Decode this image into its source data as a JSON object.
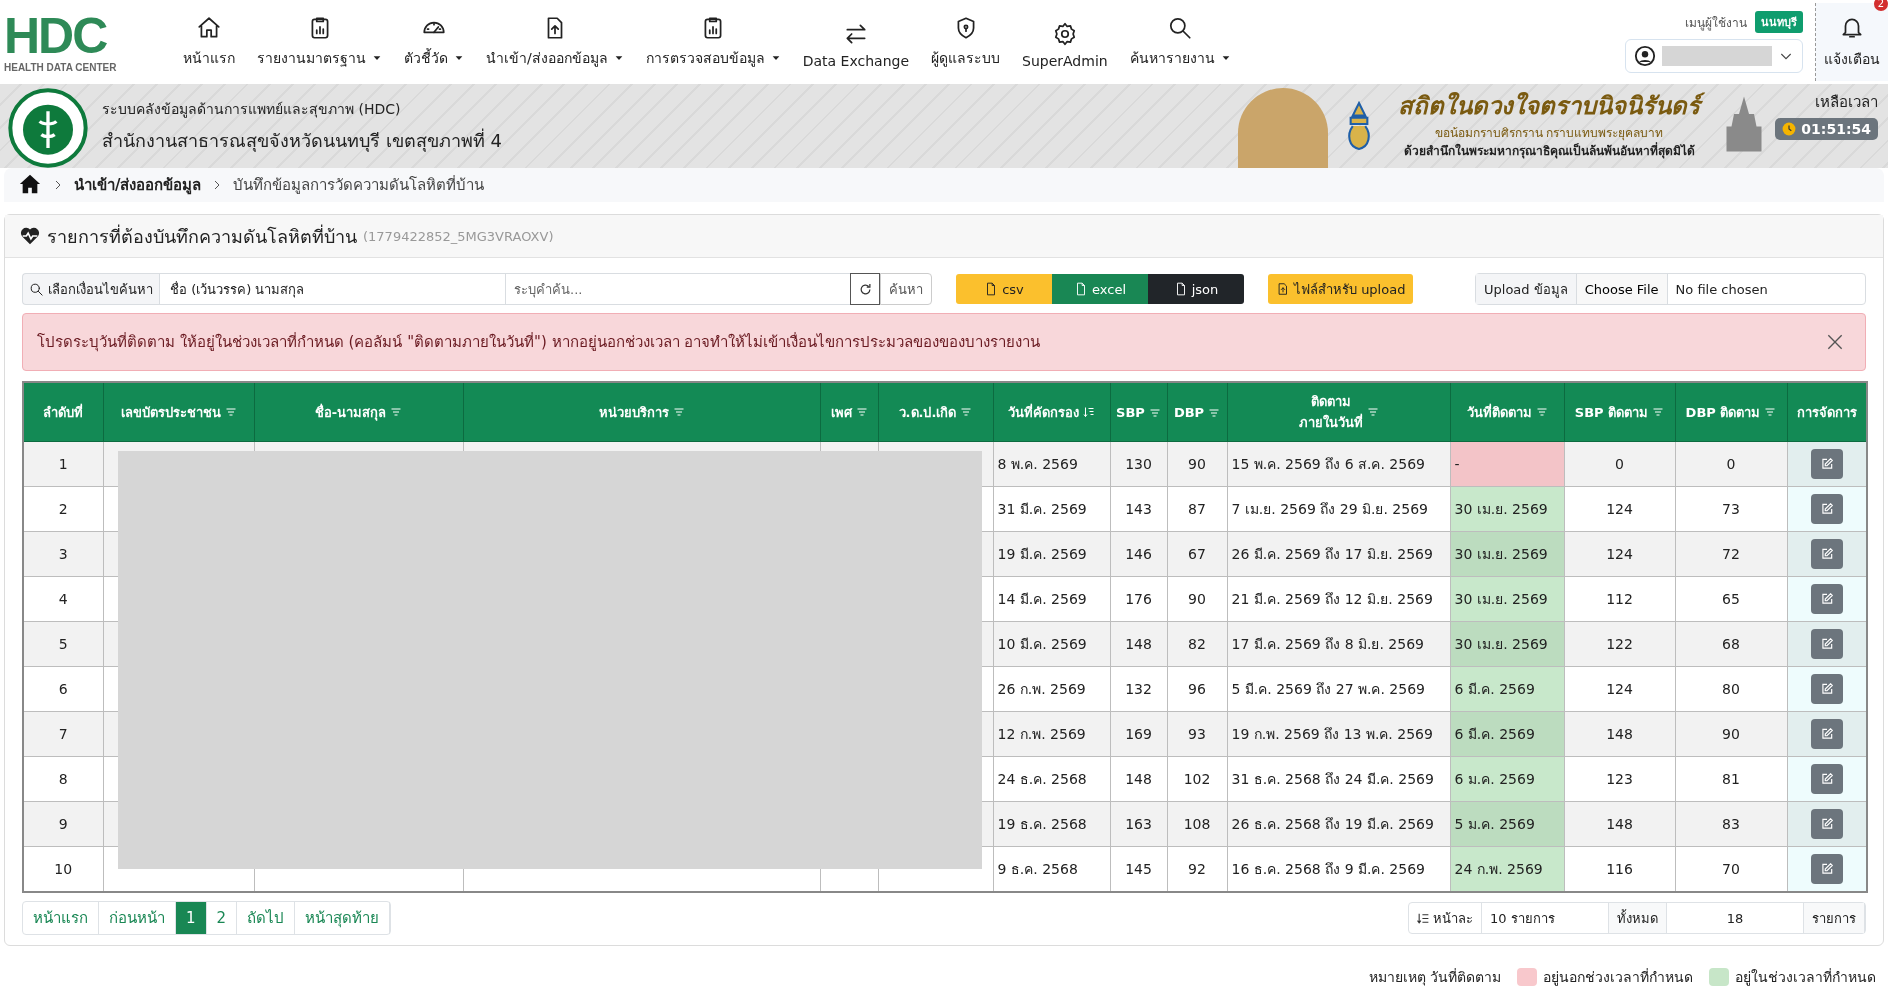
{
  "logo": {
    "mark": "HDC",
    "caption": "HEALTH DATA CENTER"
  },
  "nav": [
    {
      "label": "หน้าแรก",
      "dropdown": false
    },
    {
      "label": "รายงานมาตรฐาน",
      "dropdown": true
    },
    {
      "label": "ตัวชี้วัด",
      "dropdown": true
    },
    {
      "label": "นำเข้า/ส่งออกข้อมูล",
      "dropdown": true
    },
    {
      "label": "การตรวจสอบข้อมูล",
      "dropdown": true
    },
    {
      "label": "Data Exchange",
      "dropdown": false
    },
    {
      "label": "ผู้ดูแลระบบ",
      "dropdown": false
    },
    {
      "label": "SuperAdmin",
      "dropdown": false
    },
    {
      "label": "ค้นหารายงาน",
      "dropdown": true
    }
  ],
  "user_menu": {
    "label": "เมนูผู้ใช้งาน",
    "province": "นนทบุรี"
  },
  "notifications": {
    "label": "แจ้งเตือน",
    "count": "2"
  },
  "banner": {
    "system": "ระบบคลังข้อมูลด้านการแพทย์และสุขภาพ (HDC)",
    "office": "สำนักงานสาธารณสุขจังหวัดนนทบุรี เขตสุขภาพที่ 4",
    "headline": "สถิตในดวงใจตราบนิจนิรันดร์",
    "line_1": "ขอน้อมกราบศิรกราน กราบแทบพระยุคลบาท",
    "line_2": "ด้วยสำนึกในพระมหากรุณาธิคุณเป็นล้นพ้นอันหาที่สุดมิได้",
    "timer_label": "เหลือเวลา",
    "timer": "01:51:54"
  },
  "breadcrumb": [
    "นำเข้า/ส่งออกข้อมูล",
    "บันทึกข้อมูลการวัดความดันโลหิตที่บ้าน"
  ],
  "card": {
    "title": "รายการที่ต้องบันทึกความดันโลหิตที่บ้าน",
    "code": "(1779422852_5MG3VRAOXV)"
  },
  "search": {
    "label": "เลือกเงื่อนไขค้นหา",
    "condition": "ชื่อ (เว้นวรรค) นามสกุล",
    "placeholder": "ระบุคำค้น...",
    "button": "ค้นหา"
  },
  "exports": [
    {
      "label": "csv",
      "kind": "csv"
    },
    {
      "label": "excel",
      "kind": "excel"
    },
    {
      "label": "json",
      "kind": "json"
    }
  ],
  "upload_template": "ไฟล์สำหรับ upload",
  "upload": {
    "label": "Upload ข้อมูล",
    "button": "Choose File",
    "file": "No file chosen"
  },
  "alert": "โปรดระบุวันที่ติดตาม ให้อยู่ในช่วงเวลาที่กำหนด (คอลัมน์ \"ติดตามภายในวันที่\") หากอยู่นอกช่วงเวลา อาจทำให้ไม่เข้าเงื่อนไขการประมวลของของบางรายงาน",
  "table": {
    "columns": [
      {
        "lines": [
          "ลำดับที่"
        ]
      },
      {
        "lines": [
          "เลขบัตรประชาชน"
        ]
      },
      {
        "lines": [
          "ชื่อ-นามสกุล"
        ]
      },
      {
        "lines": [
          "หน่วยบริการ"
        ]
      },
      {
        "lines": [
          "เพศ"
        ]
      },
      {
        "lines": [
          "ว.ด.ป.เกิด"
        ]
      },
      {
        "lines": [
          "วันที่คัดกรอง"
        ]
      },
      {
        "lines": [
          "SBP"
        ]
      },
      {
        "lines": [
          "DBP"
        ]
      },
      {
        "lines": [
          "ติดตาม",
          "ภายในวันที่"
        ]
      },
      {
        "lines": [
          "วันที่ติดตาม"
        ]
      },
      {
        "lines": [
          "SBP ติดตาม"
        ]
      },
      {
        "lines": [
          "DBP ติดตาม"
        ]
      },
      {
        "lines": [
          "การจัดการ"
        ]
      }
    ],
    "rows": [
      {
        "no": "1",
        "screen_date": "8 พ.ค. 2569",
        "sbp": "130",
        "dbp": "90",
        "window": "15 พ.ค. 2569 ถึง 6 ส.ค. 2569",
        "followup_date": "-",
        "in_range": false,
        "sbp_followup": "0",
        "dbp_followup": "0"
      },
      {
        "no": "2",
        "screen_date": "31 มี.ค. 2569",
        "sbp": "143",
        "dbp": "87",
        "window": "7 เม.ย. 2569 ถึง 29 มิ.ย. 2569",
        "followup_date": "30 เม.ย. 2569",
        "in_range": true,
        "sbp_followup": "124",
        "dbp_followup": "73"
      },
      {
        "no": "3",
        "screen_date": "19 มี.ค. 2569",
        "sbp": "146",
        "dbp": "67",
        "window": "26 มี.ค. 2569 ถึง 17 มิ.ย. 2569",
        "followup_date": "30 เม.ย. 2569",
        "in_range": true,
        "sbp_followup": "124",
        "dbp_followup": "72"
      },
      {
        "no": "4",
        "screen_date": "14 มี.ค. 2569",
        "sbp": "176",
        "dbp": "90",
        "window": "21 มี.ค. 2569 ถึง 12 มิ.ย. 2569",
        "followup_date": "30 เม.ย. 2569",
        "in_range": true,
        "sbp_followup": "112",
        "dbp_followup": "65"
      },
      {
        "no": "5",
        "screen_date": "10 มี.ค. 2569",
        "sbp": "148",
        "dbp": "82",
        "window": "17 มี.ค. 2569 ถึง 8 มิ.ย. 2569",
        "followup_date": "30 เม.ย. 2569",
        "in_range": true,
        "sbp_followup": "122",
        "dbp_followup": "68"
      },
      {
        "no": "6",
        "screen_date": "26 ก.พ. 2569",
        "sbp": "132",
        "dbp": "96",
        "window": "5 มี.ค. 2569 ถึง 27 พ.ค. 2569",
        "followup_date": "6 มี.ค. 2569",
        "in_range": true,
        "sbp_followup": "124",
        "dbp_followup": "80"
      },
      {
        "no": "7",
        "screen_date": "12 ก.พ. 2569",
        "sbp": "169",
        "dbp": "93",
        "window": "19 ก.พ. 2569 ถึง 13 พ.ค. 2569",
        "followup_date": "6 มี.ค. 2569",
        "in_range": true,
        "sbp_followup": "148",
        "dbp_followup": "90"
      },
      {
        "no": "8",
        "screen_date": "24 ธ.ค. 2568",
        "sbp": "148",
        "dbp": "102",
        "window": "31 ธ.ค. 2568 ถึง 24 มี.ค. 2569",
        "followup_date": "6 ม.ค. 2569",
        "in_range": true,
        "sbp_followup": "123",
        "dbp_followup": "81"
      },
      {
        "no": "9",
        "screen_date": "19 ธ.ค. 2568",
        "sbp": "163",
        "dbp": "108",
        "window": "26 ธ.ค. 2568 ถึง 19 มี.ค. 2569",
        "followup_date": "5 ม.ค. 2569",
        "in_range": true,
        "sbp_followup": "148",
        "dbp_followup": "83"
      },
      {
        "no": "10",
        "screen_date": "9 ธ.ค. 2568",
        "sbp": "145",
        "dbp": "92",
        "window": "16 ธ.ค. 2568 ถึง 9 มี.ค. 2569",
        "followup_date": "24 ก.พ. 2569",
        "in_range": true,
        "sbp_followup": "116",
        "dbp_followup": "70"
      }
    ]
  },
  "pagination": [
    {
      "label": "หน้าแรก",
      "selected": false
    },
    {
      "label": "ก่อนหน้า",
      "selected": false
    },
    {
      "label": "1",
      "selected": true
    },
    {
      "label": "2",
      "selected": false
    },
    {
      "label": "ถัดไป",
      "selected": false
    },
    {
      "label": "หน้าสุดท้าย",
      "selected": false
    }
  ],
  "page_size": {
    "label": "หน้าละ",
    "value": "10 รายการ",
    "total_label": "ทั้งหมด",
    "total": "18",
    "unit": "รายการ"
  },
  "legend": {
    "title": "หมายเหตุ วันที่ติดตาม",
    "items": [
      {
        "label": "อยู่นอกช่วงเวลาที่กำหนด",
        "color": "#f8c8cc"
      },
      {
        "label": "อยู่ในช่วงเวลาที่กำหนด",
        "color": "#c7e6c8"
      }
    ]
  }
}
